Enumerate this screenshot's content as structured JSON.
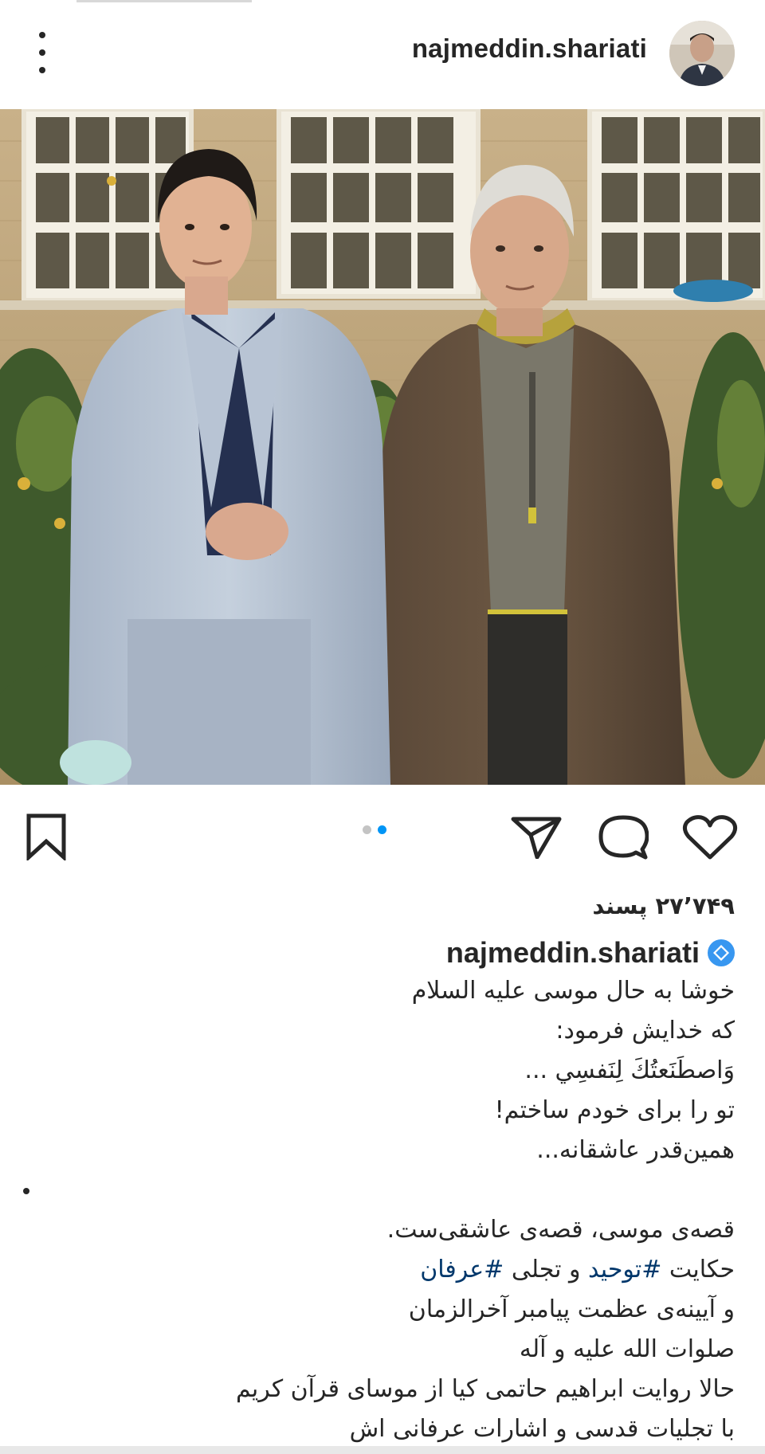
{
  "post": {
    "username": "najmeddin.shariati",
    "likes_text": "۲۷٬۷۴۹ پسند",
    "carousel": {
      "total": 2,
      "active_index": 2
    }
  },
  "caption": {
    "username": "najmeddin.shariati",
    "block1": [
      "خوشا به حال موسی علیه السلام",
      "که خدایش فرمود:",
      "وَاصطَنَعتُكَ لِنَفسِي ...",
      "تو را برای خودم ساختم!",
      "همین‌قدر عاشقانه..."
    ],
    "block2": {
      "line1": "قصه‌ی موسی، قصه‌ی عاشقی‌ست.",
      "line2_prefix": "حکایت ",
      "hashtag1": "#توحید",
      "line2_middle": " و تجلی ",
      "hashtag2": "#عرفان",
      "line3": "و آیینه‌ی عظمت پیامبر آخرالزمان",
      "line4": "صلوات الله علیه و آله",
      "line5": "حالا روایت ابراهیم حاتمی کیا از موسای قرآن کریم",
      "line6": "با تجلیات قدسی و اشارات عرفانی اش"
    }
  },
  "icons": {
    "more": "more-vertical-icon",
    "like": "heart-icon",
    "comment": "comment-icon",
    "share": "paper-plane-icon",
    "save": "bookmark-icon",
    "verified": "verified-badge-icon"
  },
  "colors": {
    "text": "#262626",
    "hashtag": "#00376b",
    "carousel_active": "#0095f6",
    "verified": "#3897f0"
  }
}
